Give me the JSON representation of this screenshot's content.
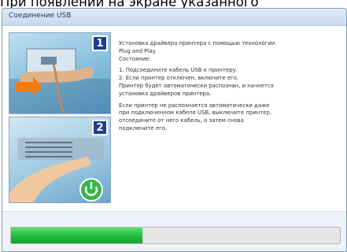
{
  "caption": "При появлении на экране указанного",
  "window": {
    "title": "Соединение USB"
  },
  "panels": [
    {
      "number": "1",
      "image": "usb-cable-connect-illustration"
    },
    {
      "number": "2",
      "image": "printer-power-button-illustration"
    }
  ],
  "instructions": {
    "intro": [
      "Установка драйвера принтера с помощью технологии",
      "Plug and Play."
    ],
    "status_label": "Состояние:",
    "steps": [
      "1. Подсоедините кабель USB к принтеру.",
      "2. Если принтер отключен, включите его.",
      "Принтер будет автоматически распознан, и начнется",
      "установка драйверов принтера."
    ],
    "note": [
      "Если принтер не распознается автоматически даже",
      "при подключенном кабеле USB, выключите принтер,",
      "отсоедините от него кабель, а затем снова",
      "подключите его."
    ]
  },
  "progress": {
    "fraction": 0.4
  },
  "colors": {
    "progress_fill": "#1fbd3c",
    "badge": "#1f3d8f",
    "power_icon": "#39b54a"
  }
}
